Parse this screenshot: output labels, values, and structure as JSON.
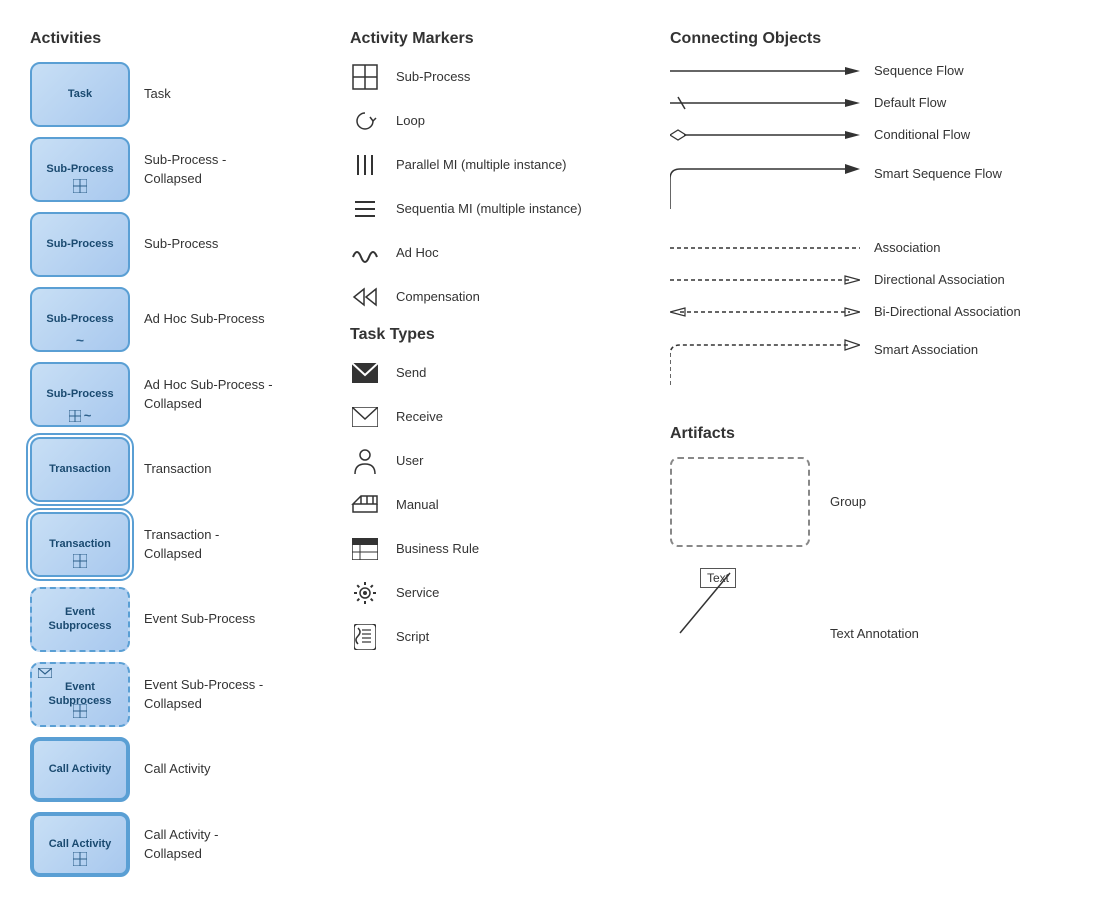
{
  "sections": {
    "activities": {
      "title": "Activities",
      "items": [
        {
          "id": "task",
          "label": "Task",
          "box_text": "Task",
          "style": "normal"
        },
        {
          "id": "sub-process-collapsed",
          "label": "Sub-Process -\nCollapsed",
          "box_text": "Sub-Process",
          "style": "normal",
          "bottom": "grid"
        },
        {
          "id": "sub-process",
          "label": "Sub-Process",
          "box_text": "Sub-Process",
          "style": "normal"
        },
        {
          "id": "ad-hoc-sub-process",
          "label": "Ad Hoc Sub-Process",
          "box_text": "Sub-Process",
          "style": "normal",
          "bottom": "tilde"
        },
        {
          "id": "ad-hoc-sub-process-collapsed",
          "label": "Ad Hoc Sub-Process -\nCollapsed",
          "box_text": "Sub-Process",
          "style": "normal",
          "bottom": "grid-tilde"
        },
        {
          "id": "transaction",
          "label": "Transaction",
          "box_text": "Transaction",
          "style": "double"
        },
        {
          "id": "transaction-collapsed",
          "label": "Transaction -\nCollapsed",
          "box_text": "Transaction",
          "style": "double",
          "bottom": "grid"
        },
        {
          "id": "event-sub-process",
          "label": "Event Sub-Process",
          "box_text": "Event\nSubprocess",
          "style": "normal"
        },
        {
          "id": "event-sub-process-collapsed",
          "label": "Event Sub-Process -\nCollapsed",
          "box_text": "Event\nSubprocess",
          "style": "normal",
          "top": "envelope",
          "bottom": "grid"
        },
        {
          "id": "call-activity",
          "label": "Call Activity",
          "box_text": "Call Activity",
          "style": "thick"
        },
        {
          "id": "call-activity-collapsed",
          "label": "Call Activity -\nCollapsed",
          "box_text": "Call Activity",
          "style": "thick",
          "bottom": "grid"
        }
      ]
    },
    "activity_markers": {
      "title": "Activity Markers",
      "items": [
        {
          "id": "sub-process",
          "icon": "grid",
          "label": "Sub-Process"
        },
        {
          "id": "loop",
          "icon": "loop",
          "label": "Loop"
        },
        {
          "id": "parallel-mi",
          "icon": "parallel",
          "label": "Parallel MI (multiple instance)"
        },
        {
          "id": "sequential-mi",
          "icon": "sequential",
          "label": "Sequentia MI (multiple instance)"
        },
        {
          "id": "adhoc",
          "icon": "adhoc",
          "label": "Ad Hoc"
        },
        {
          "id": "compensation",
          "icon": "compensation",
          "label": "Compensation"
        }
      ]
    },
    "task_types": {
      "title": "Task Types",
      "items": [
        {
          "id": "send",
          "icon": "send",
          "label": "Send"
        },
        {
          "id": "receive",
          "icon": "receive",
          "label": "Receive"
        },
        {
          "id": "user",
          "icon": "user",
          "label": "User"
        },
        {
          "id": "manual",
          "icon": "manual",
          "label": "Manual"
        },
        {
          "id": "business-rule",
          "icon": "business-rule",
          "label": "Business Rule"
        },
        {
          "id": "service",
          "icon": "service",
          "label": "Service"
        },
        {
          "id": "script",
          "icon": "script",
          "label": "Script"
        }
      ]
    },
    "connecting_objects": {
      "title": "Connecting Objects",
      "items": [
        {
          "id": "sequence-flow",
          "label": "Sequence Flow",
          "type": "solid-arrow"
        },
        {
          "id": "default-flow",
          "label": "Default Flow",
          "type": "default-arrow"
        },
        {
          "id": "conditional-flow",
          "label": "Conditional Flow",
          "type": "conditional-arrow"
        },
        {
          "id": "smart-sequence-flow",
          "label": "Smart Sequence Flow",
          "type": "smart-arrow"
        },
        {
          "id": "association",
          "label": "Association",
          "type": "dotted"
        },
        {
          "id": "directional-association",
          "label": "Directional Association",
          "type": "dotted-arrow"
        },
        {
          "id": "bi-directional-association",
          "label": "Bi-Directional Association",
          "type": "bi-dotted-arrow"
        },
        {
          "id": "smart-association",
          "label": "Smart Association",
          "type": "smart-dotted"
        }
      ]
    },
    "artifacts": {
      "title": "Artifacts",
      "items": [
        {
          "id": "group",
          "label": "Group"
        },
        {
          "id": "text-annotation",
          "label": "Text Annotation",
          "text": "Text"
        }
      ]
    }
  }
}
